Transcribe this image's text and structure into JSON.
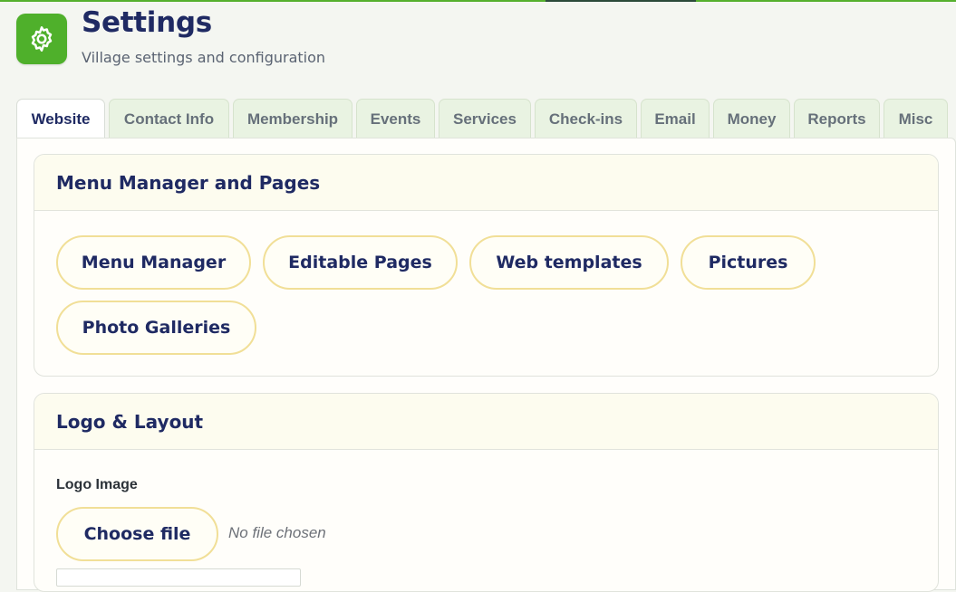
{
  "colors": {
    "accent": "#4fb02b",
    "title": "#1f2a63",
    "pill_border": "#f1df97",
    "card_header_bg": "#fdfcef",
    "tab_bg": "#e9f3e2"
  },
  "header": {
    "icon": "gear-icon",
    "title": "Settings",
    "subtitle": "Village settings and configuration"
  },
  "tabs": [
    {
      "label": "Website",
      "active": true
    },
    {
      "label": "Contact Info",
      "active": false
    },
    {
      "label": "Membership",
      "active": false
    },
    {
      "label": "Events",
      "active": false
    },
    {
      "label": "Services",
      "active": false
    },
    {
      "label": "Check-ins",
      "active": false
    },
    {
      "label": "Email",
      "active": false
    },
    {
      "label": "Money",
      "active": false
    },
    {
      "label": "Reports",
      "active": false
    },
    {
      "label": "Misc",
      "active": false
    }
  ],
  "menu_section": {
    "title": "Menu Manager and Pages",
    "buttons": [
      "Menu Manager",
      "Editable Pages",
      "Web templates",
      "Pictures",
      "Photo Galleries"
    ]
  },
  "logo_section": {
    "title": "Logo & Layout",
    "logo_label": "Logo Image",
    "choose_file_label": "Choose file",
    "file_status": "No file chosen"
  }
}
